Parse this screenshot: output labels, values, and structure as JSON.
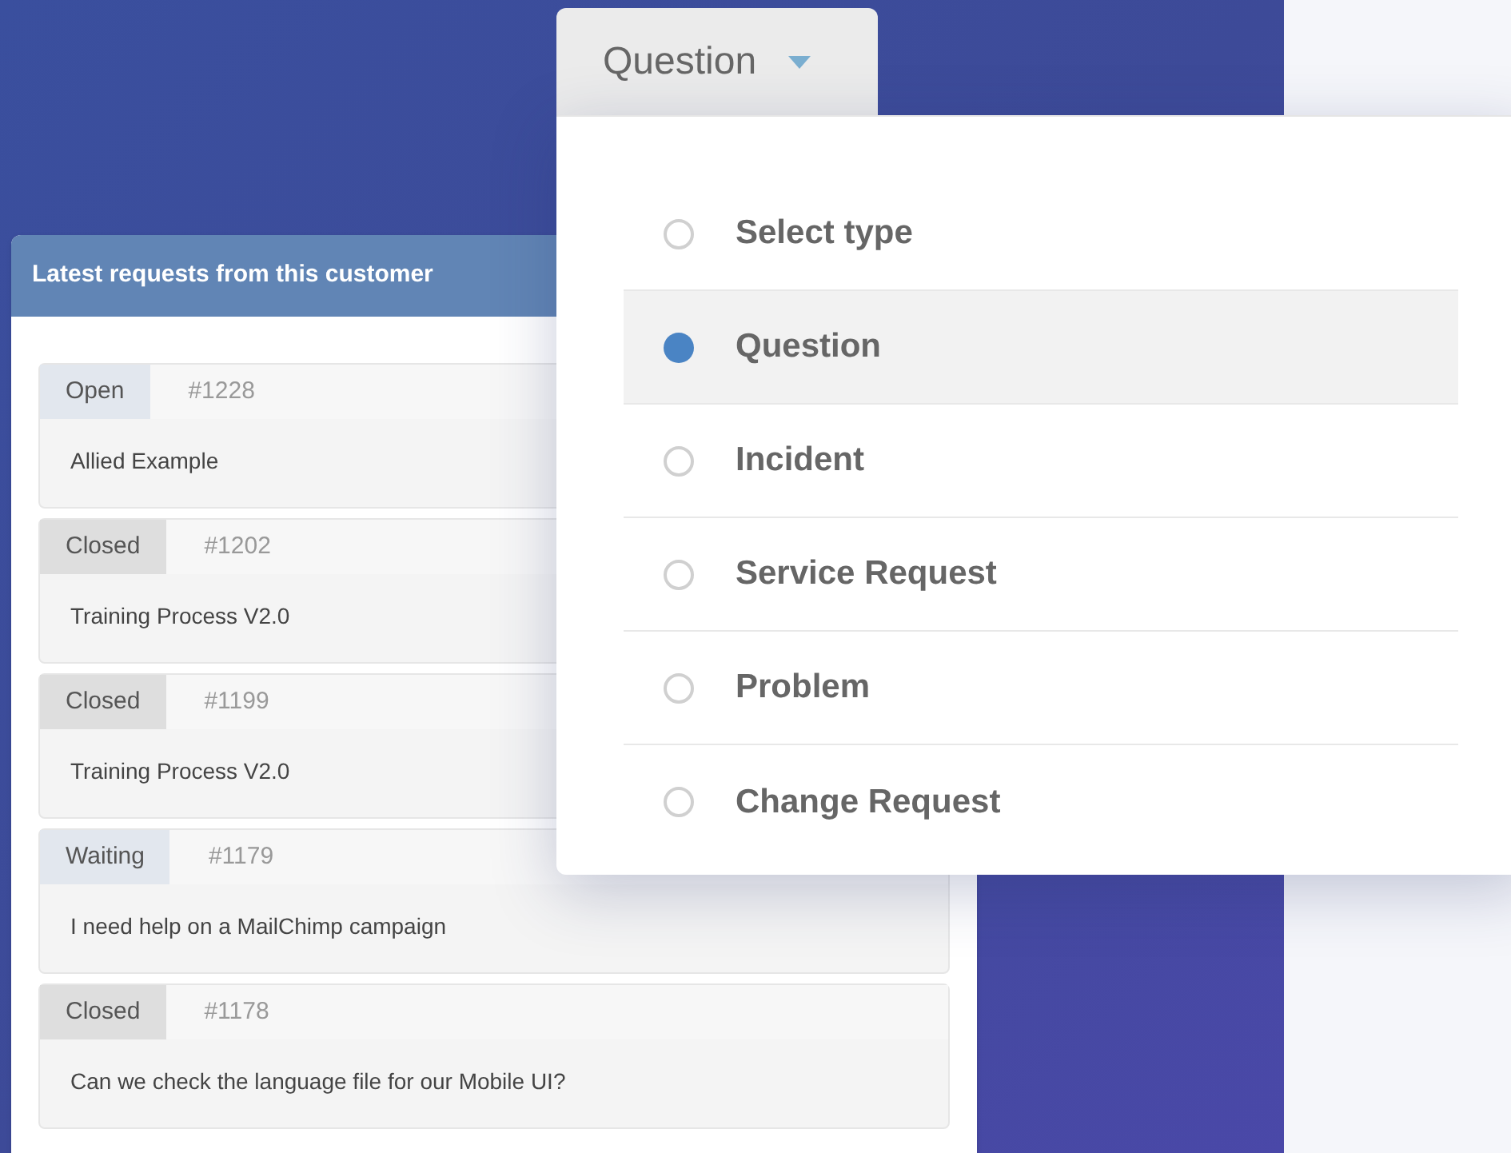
{
  "requests_card": {
    "title": "Latest requests from this customer",
    "requests": [
      {
        "status": "Open",
        "color": "#e2e7ee",
        "number": "#1228",
        "subject": "Allied Example"
      },
      {
        "status": "Closed",
        "color": "#dedede",
        "number": "#1202",
        "subject": "Training Process V2.0"
      },
      {
        "status": "Closed",
        "color": "#dedede",
        "number": "#1199",
        "subject": "Training Process V2.0"
      },
      {
        "status": "Waiting",
        "color": "#e2e7ee",
        "number": "#1179",
        "subject": "I need help on a MailChimp campaign"
      },
      {
        "status": "Closed",
        "color": "#dedede",
        "number": "#1178",
        "subject": "Can we check the language file for our Mobile UI?"
      }
    ]
  },
  "type_dropdown": {
    "value": "Question",
    "options": [
      {
        "label": "Select type",
        "selected": false
      },
      {
        "label": "Question",
        "selected": true
      },
      {
        "label": "Incident",
        "selected": false
      },
      {
        "label": "Service Request",
        "selected": false
      },
      {
        "label": "Problem",
        "selected": false
      },
      {
        "label": "Change Request",
        "selected": false
      }
    ]
  }
}
